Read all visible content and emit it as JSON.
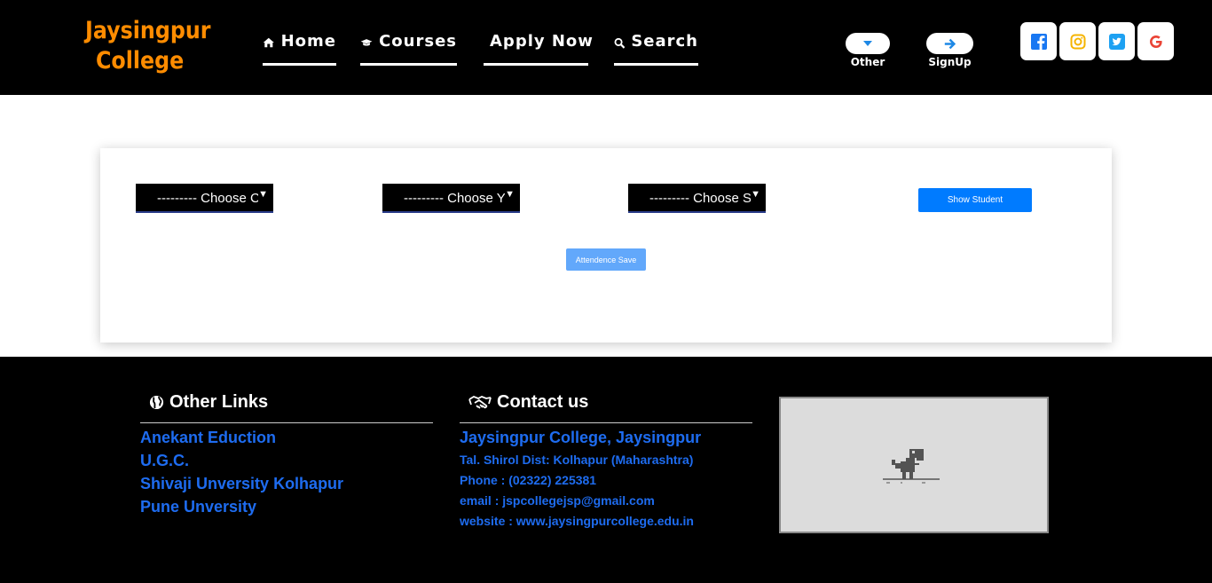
{
  "header": {
    "brand": {
      "line1": "Jaysingpur",
      "line2": "College"
    },
    "nav": [
      {
        "label": "Home",
        "icon": "home-icon"
      },
      {
        "label": "Courses",
        "icon": "graduation-cap-icon"
      },
      {
        "label": "Apply Now",
        "icon": "arrow-right-icon"
      },
      {
        "label": "Search",
        "icon": "search-icon"
      }
    ],
    "actions": [
      {
        "label": "Other",
        "icon": "caret-down-icon"
      },
      {
        "label": "SignUp",
        "icon": "arrow-right-icon"
      }
    ],
    "social": [
      {
        "icon": "facebook-icon",
        "color": "#1877f2"
      },
      {
        "icon": "instagram-icon",
        "color": "#f5b400"
      },
      {
        "icon": "twitter-icon",
        "color": "#1da1f2"
      },
      {
        "icon": "google-icon",
        "color": "#ea4335"
      }
    ]
  },
  "form": {
    "selects": [
      {
        "value": "--------- Choose Class"
      },
      {
        "value": "--------- Choose Year"
      },
      {
        "value": "--------- Choose Subject"
      }
    ],
    "show_button": "Show Student",
    "save_button": "Attendence Save"
  },
  "footer": {
    "links_heading": "Other Links",
    "links": [
      "Anekant Eduction",
      "U.G.C.",
      "Shivaji Unversity Kolhapur",
      "Pune Unversity"
    ],
    "contact_heading": "Contact us",
    "contact": {
      "title": "Jaysingpur College, Jaysingpur",
      "address": "Tal. Shirol Dist: Kolhapur (Maharashtra)",
      "phone": "Phone : (02322) 225381",
      "email": "email : jspcollegejsp@gmail.com",
      "website": "website : www.jaysingpurcollege.edu.in"
    }
  },
  "colors": {
    "brand": "#ff8c00",
    "primary": "#007bff",
    "link": "#1e6cf0",
    "header_bg": "#000000"
  }
}
